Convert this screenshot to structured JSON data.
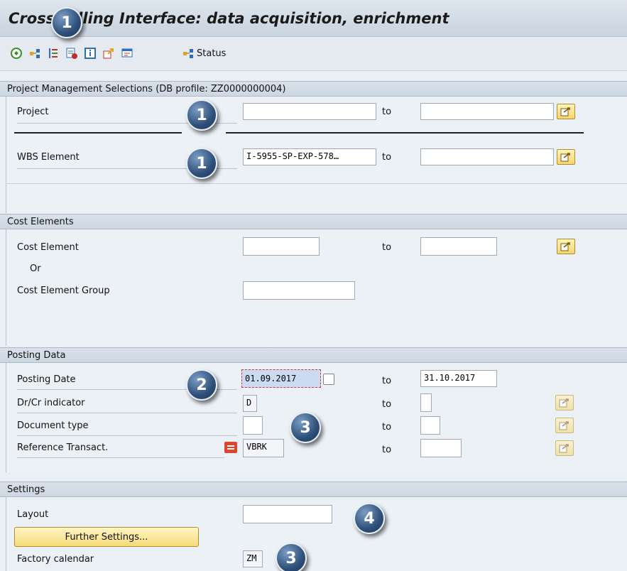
{
  "header": {
    "title": "Cross-Billing Interface: data acquisition, enrichment",
    "status_label": "Status"
  },
  "toolbar_icons": [
    "execute-icon",
    "modules-icon",
    "list-icon",
    "variant-icon",
    "info-icon",
    "export-icon",
    "dialog-icon",
    "status-icon"
  ],
  "sections": {
    "project": {
      "title": "Project Management Selections (DB profile: ZZ0000000004)",
      "project_label": "Project",
      "project_from": "",
      "project_to": "",
      "wbs_label": "WBS Element",
      "wbs_from": "I-5955-SP-EXP-578…",
      "wbs_to": ""
    },
    "cost": {
      "title": "Cost Elements",
      "cost_element_label": "Cost Element",
      "cost_element_from": "",
      "cost_element_to": "",
      "or_label": "Or",
      "group_label": "Cost Element Group",
      "group_value": ""
    },
    "posting": {
      "title": "Posting Data",
      "date_label": "Posting Date",
      "date_from": "01.09.2017",
      "date_to": "31.10.2017",
      "drcr_label": "Dr/Cr indicator",
      "drcr_from": "D",
      "drcr_to": "",
      "doctype_label": "Document type",
      "doctype_from": "",
      "doctype_to": "",
      "reftrans_label": "Reference Transact.",
      "reftrans_from": "VBRK",
      "reftrans_to": ""
    },
    "settings": {
      "title": "Settings",
      "layout_label": "Layout",
      "layout_value": "",
      "further_button": "Further Settings...",
      "calendar_label": "Factory calendar",
      "calendar_value": "ZM"
    }
  },
  "to_label": "to",
  "badges": {
    "b1": "1",
    "b2": "2",
    "b3": "3",
    "b4": "4"
  },
  "colors": {
    "accent_button": "#f5db78",
    "badge": "#2e4f79",
    "highlight_field": "#c9dcf1"
  }
}
